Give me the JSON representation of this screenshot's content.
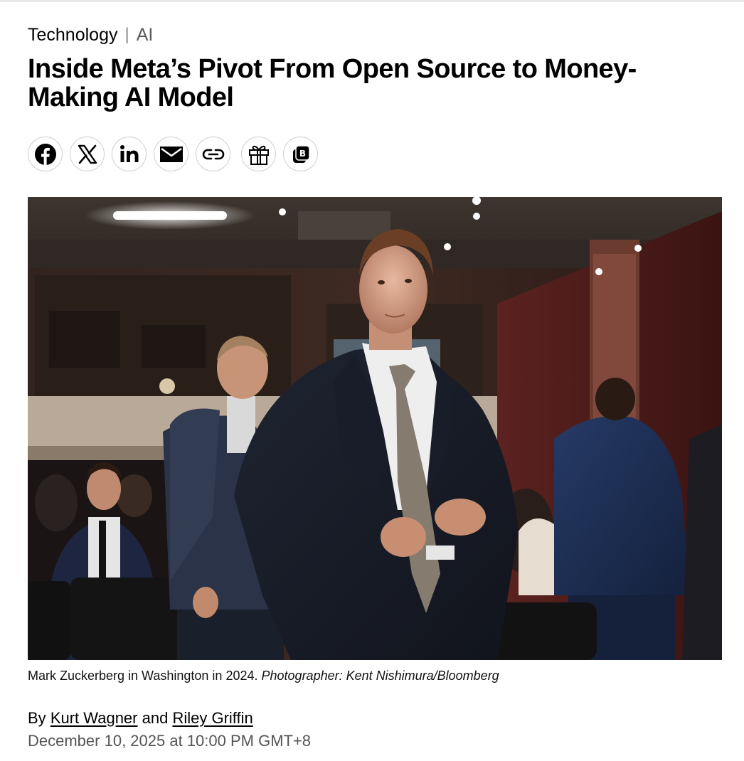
{
  "breadcrumb": {
    "section": "Technology",
    "separator": "|",
    "subsection": "AI"
  },
  "article": {
    "headline": "Inside Meta’s Pivot From Open Source to Money-Making AI Model"
  },
  "share": {
    "buttons": [
      {
        "icon": "facebook-icon"
      },
      {
        "icon": "x-icon"
      },
      {
        "icon": "linkedin-icon"
      },
      {
        "icon": "email-icon"
      },
      {
        "icon": "link-icon"
      },
      {
        "icon": "gift-icon"
      },
      {
        "icon": "bookmark-icon"
      }
    ]
  },
  "photo": {
    "caption": "Mark Zuckerberg in Washington in 2024.",
    "credit": "Photographer: Kent Nishimura/Bloomberg"
  },
  "byline": {
    "prefix": "By",
    "author_1": "Kurt Wagner",
    "conjunction": "and",
    "author_2": "Riley Griffin",
    "date": "December 10, 2025 at 10:00 PM GMT+8"
  },
  "colors": {
    "text": "#000000",
    "muted": "#555555",
    "icon_border": "#cfcfcf"
  }
}
